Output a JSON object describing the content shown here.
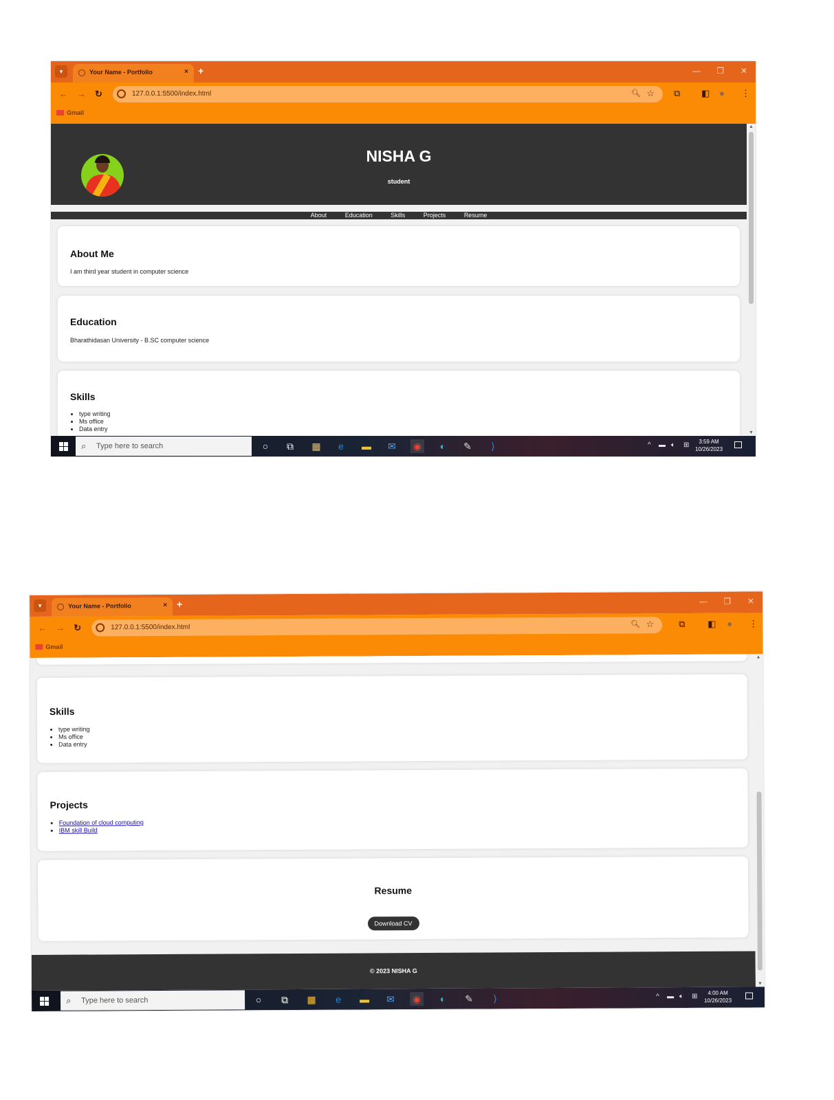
{
  "browser": {
    "tab_title": "Your Name - Portfolio",
    "tab_close": "×",
    "new_tab": "+",
    "url": "127.0.0.1:5500/index.html",
    "bookmark": "Gmail",
    "theme_color": "#fb8a05"
  },
  "site": {
    "name": "NISHA G",
    "tagline": "student",
    "nav": [
      "About",
      "Education",
      "Skills",
      "Projects",
      "Resume"
    ],
    "about": {
      "heading": "About Me",
      "text": "I am third year student in computer science"
    },
    "education": {
      "heading": "Education",
      "text": "Bharathidasan University - B.SC computer science"
    },
    "skills": {
      "heading": "Skills",
      "items": [
        "type writing",
        "Ms office",
        "Data entry"
      ]
    },
    "projects": {
      "heading": "Projects",
      "items": [
        "Foundation of cloud computing",
        "IBM skill Build"
      ]
    },
    "resume": {
      "heading": "Resume",
      "button": "Download CV"
    },
    "footer": "© 2023 NISHA G"
  },
  "taskbar": {
    "search_placeholder": "Type here to search",
    "shot1_time": "3:59 AM",
    "shot2_time": "4:00 AM",
    "date": "10/26/2023"
  }
}
